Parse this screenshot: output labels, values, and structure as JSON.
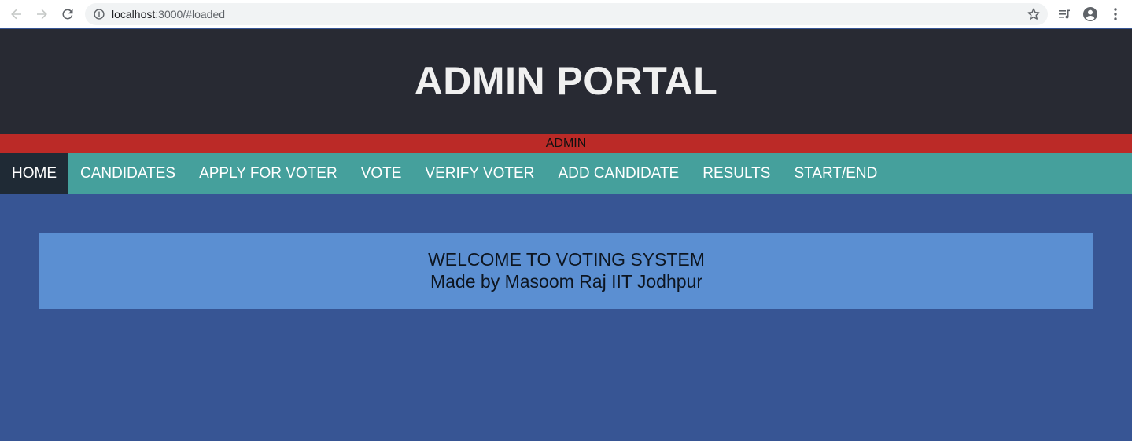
{
  "browser": {
    "url_host": "localhost",
    "url_path": ":3000/#loaded",
    "icons": [
      "back-arrow-icon",
      "forward-arrow-icon",
      "reload-icon",
      "info-icon",
      "star-icon",
      "media-control-icon",
      "account-icon",
      "more-vert-icon"
    ]
  },
  "header": {
    "title": "ADMIN PORTAL"
  },
  "role_strip": {
    "label": "ADMIN"
  },
  "nav": {
    "items": [
      {
        "label": "HOME",
        "active": true
      },
      {
        "label": "CANDIDATES",
        "active": false
      },
      {
        "label": "APPLY FOR VOTER",
        "active": false
      },
      {
        "label": "VOTE",
        "active": false
      },
      {
        "label": "VERIFY VOTER",
        "active": false
      },
      {
        "label": "ADD CANDIDATE",
        "active": false
      },
      {
        "label": "RESULTS",
        "active": false
      },
      {
        "label": "START/END",
        "active": false
      }
    ]
  },
  "main": {
    "welcome_line1": "WELCOME TO VOTING SYSTEM",
    "welcome_line2": "Made by Masoom Raj IIT Jodhpur"
  },
  "colors": {
    "header_bg": "#282a33",
    "admin_strip_bg": "#bb2a27",
    "nav_bg": "#45a09c",
    "nav_active_bg": "#1f2a35",
    "page_bg": "#375594",
    "welcome_bg": "#5b8fd2"
  }
}
